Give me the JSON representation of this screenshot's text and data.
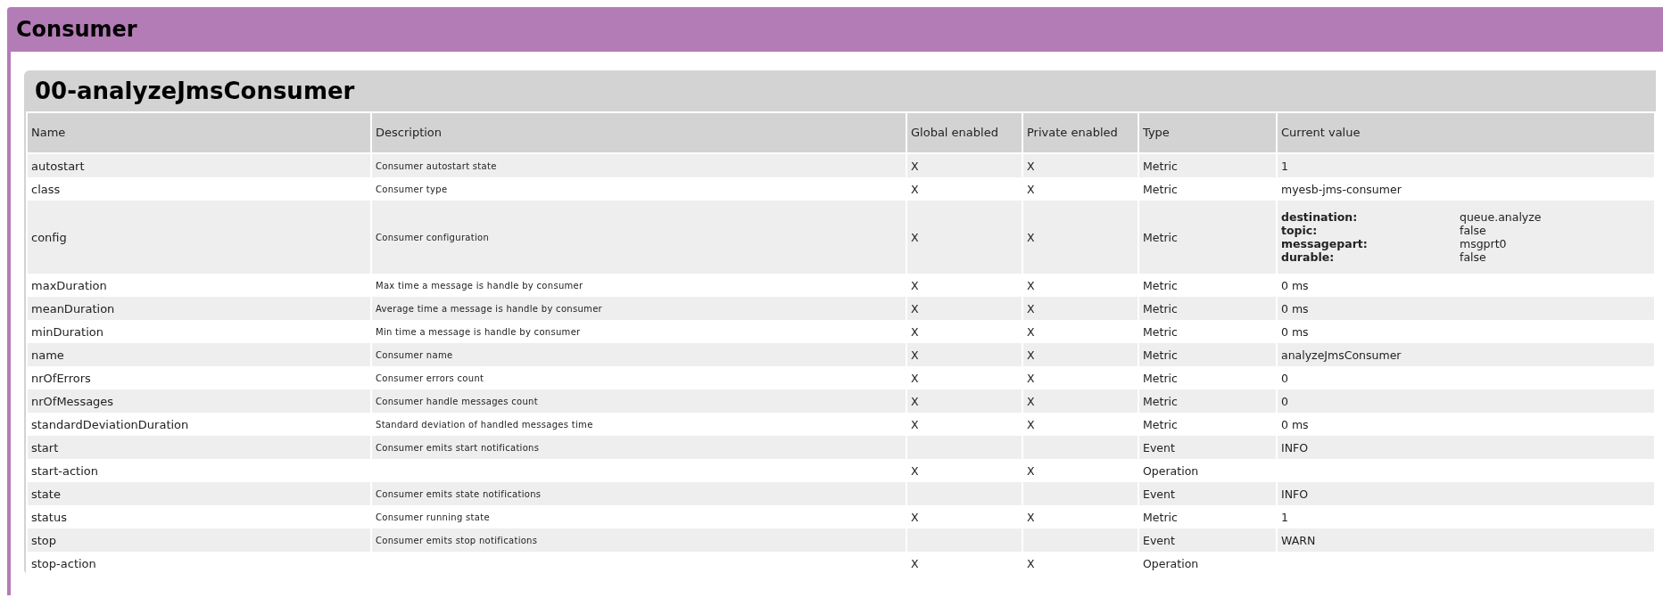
{
  "panel": {
    "title": "Consumer"
  },
  "consumer": {
    "title": "00-analyzeJmsConsumer",
    "columns": [
      "Name",
      "Description",
      "Global enabled",
      "Private enabled",
      "Type",
      "Current value"
    ],
    "rows": [
      {
        "name": "autostart",
        "description": "Consumer autostart state",
        "global_enabled": "X",
        "private_enabled": "X",
        "type": "Metric",
        "value": "1"
      },
      {
        "name": "class",
        "description": "Consumer type",
        "global_enabled": "X",
        "private_enabled": "X",
        "type": "Metric",
        "value": "myesb-jms-consumer"
      },
      {
        "name": "config",
        "description": "Consumer configuration",
        "global_enabled": "X",
        "private_enabled": "X",
        "type": "Metric",
        "value_pairs": [
          {
            "key": "destination:",
            "value": "queue.analyze"
          },
          {
            "key": "topic:",
            "value": "false"
          },
          {
            "key": "messagepart:",
            "value": "msgprt0"
          },
          {
            "key": "durable:",
            "value": "false"
          }
        ]
      },
      {
        "name": "maxDuration",
        "description": "Max time a message is handle by consumer",
        "global_enabled": "X",
        "private_enabled": "X",
        "type": "Metric",
        "value": "0 ms"
      },
      {
        "name": "meanDuration",
        "description": "Average time a message is handle by consumer",
        "global_enabled": "X",
        "private_enabled": "X",
        "type": "Metric",
        "value": "0 ms"
      },
      {
        "name": "minDuration",
        "description": "Min time a message is handle by consumer",
        "global_enabled": "X",
        "private_enabled": "X",
        "type": "Metric",
        "value": "0 ms"
      },
      {
        "name": "name",
        "description": "Consumer name",
        "global_enabled": "X",
        "private_enabled": "X",
        "type": "Metric",
        "value": "analyzeJmsConsumer"
      },
      {
        "name": "nrOfErrors",
        "description": "Consumer errors count",
        "global_enabled": "X",
        "private_enabled": "X",
        "type": "Metric",
        "value": "0"
      },
      {
        "name": "nrOfMessages",
        "description": "Consumer handle messages count",
        "global_enabled": "X",
        "private_enabled": "X",
        "type": "Metric",
        "value": "0"
      },
      {
        "name": "standardDeviationDuration",
        "description": "Standard deviation of handled messages time",
        "global_enabled": "X",
        "private_enabled": "X",
        "type": "Metric",
        "value": "0 ms"
      },
      {
        "name": "start",
        "description": "Consumer emits start notifications",
        "type": "Event",
        "value": "INFO"
      },
      {
        "name": "start-action",
        "global_enabled": "X",
        "private_enabled": "X",
        "type": "Operation"
      },
      {
        "name": "state",
        "description": "Consumer emits state notifications",
        "type": "Event",
        "value": "INFO"
      },
      {
        "name": "status",
        "description": "Consumer running state",
        "global_enabled": "X",
        "private_enabled": "X",
        "type": "Metric",
        "value": "1"
      },
      {
        "name": "stop",
        "description": "Consumer emits stop notifications",
        "type": "Event",
        "value": "WARN"
      },
      {
        "name": "stop-action",
        "global_enabled": "X",
        "private_enabled": "X",
        "type": "Operation"
      }
    ]
  }
}
